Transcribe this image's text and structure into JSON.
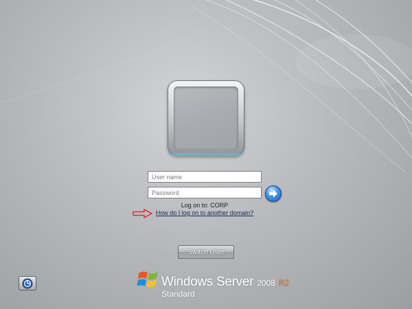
{
  "login": {
    "username_placeholder": "User name",
    "password_placeholder": "Password",
    "logon_to": "Log on to: CORP",
    "domain_help_link": "How do I log on to another domain?"
  },
  "switch_user_label": "Switch User",
  "icons": {
    "submit": "arrow-right-icon",
    "accessibility": "ease-of-access-icon",
    "annotation": "red-arrow-icon",
    "brand": "windows-flag-icon"
  },
  "branding": {
    "product": "Windows Server",
    "version": "2008",
    "release": "R2",
    "edition": "Standard"
  },
  "colors": {
    "annotation_arrow": "#e02020",
    "release_accent": "#e4761a",
    "submit_button": "#1f6fd0"
  }
}
